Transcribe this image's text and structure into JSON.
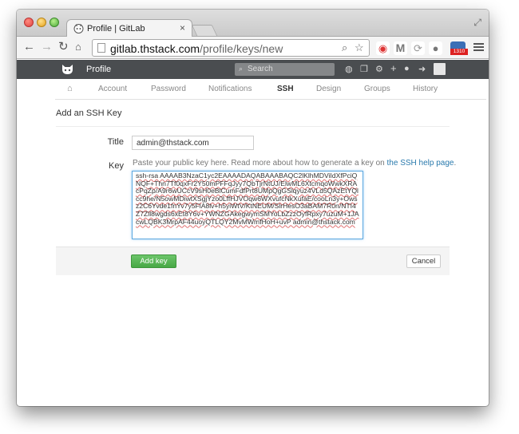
{
  "browser": {
    "tab_title": "Profile | GitLab",
    "tab_close": "×",
    "url_host": "gitlab.thstack.com",
    "url_path": "/profile/keys/new",
    "ext_badge": "1310"
  },
  "header": {
    "title": "Profile",
    "search_placeholder": "Search"
  },
  "subnav": {
    "items": [
      {
        "label": "Account"
      },
      {
        "label": "Password"
      },
      {
        "label": "Notifications"
      },
      {
        "label": "SSH"
      },
      {
        "label": "Design"
      },
      {
        "label": "Groups"
      },
      {
        "label": "History"
      }
    ],
    "active": "SSH"
  },
  "form": {
    "heading": "Add an SSH Key",
    "title_label": "Title",
    "title_value": "admin@thstack.com",
    "key_label": "Key",
    "key_help": "Paste your public key here. Read more about how to generate a key on ",
    "key_help_link": "the SSH help page",
    "key_help_end": ".",
    "key_value": "ssh-rsa AAAAB3NzaC1yc2EAAAADAQABAAABAQC2lKlhMDViIdXfPciQNQF+Thn7Tf0qxFr2Y50mPFFqJyy7QbTjrNtUJ/ElwML6XtcmqoWwkXRAcPqZp/A9r6wUCcV9sH0eBlCumFdfPrt8UMpQgGSlqyuz4VLd5QAzEtYQlcc9he/N5owMDiwtXSgjYzo0LffHJVOqw6WXvufcNkXufaE/cooLn3y+Owsz2C6Yvde1fnYv7y5FlA8lv+h5yiWtV/KtNEUM/SlrHesO3aBAM7R0n/NTI4Z7Zll8wgds6xEt8Y6v+YWNZGAkegwymSMYoLbZzzOyfRpxy7uzuM+1JAcwLQBK3MrpAF44uoyQTLQY2MvMWmfHoH+uvP admin@thstack.com",
    "add_button": "Add key",
    "cancel_button": "Cancel"
  },
  "colors": {
    "header_bg": "#4a4d50",
    "add_button": "#47a845",
    "link": "#2a7aad"
  }
}
